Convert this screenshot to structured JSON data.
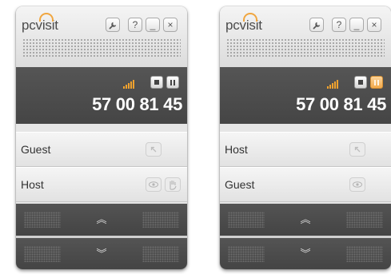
{
  "left": {
    "logo": "pcvisit",
    "code": "57 00 81 45",
    "rows": [
      {
        "label": "Guest"
      },
      {
        "label": "Host"
      }
    ]
  },
  "right": {
    "logo": "pcvisit",
    "code": "57 00 81 45",
    "rows": [
      {
        "label": "Host"
      },
      {
        "label": "Guest"
      }
    ]
  },
  "icons": {
    "wrench": "wrench-icon",
    "help": "?",
    "minimize": "_",
    "close": "×",
    "scroll_up": "︽",
    "scroll_down": "︾"
  },
  "colors": {
    "accent": "#f0a22e",
    "dark": "#4a4a4a"
  }
}
